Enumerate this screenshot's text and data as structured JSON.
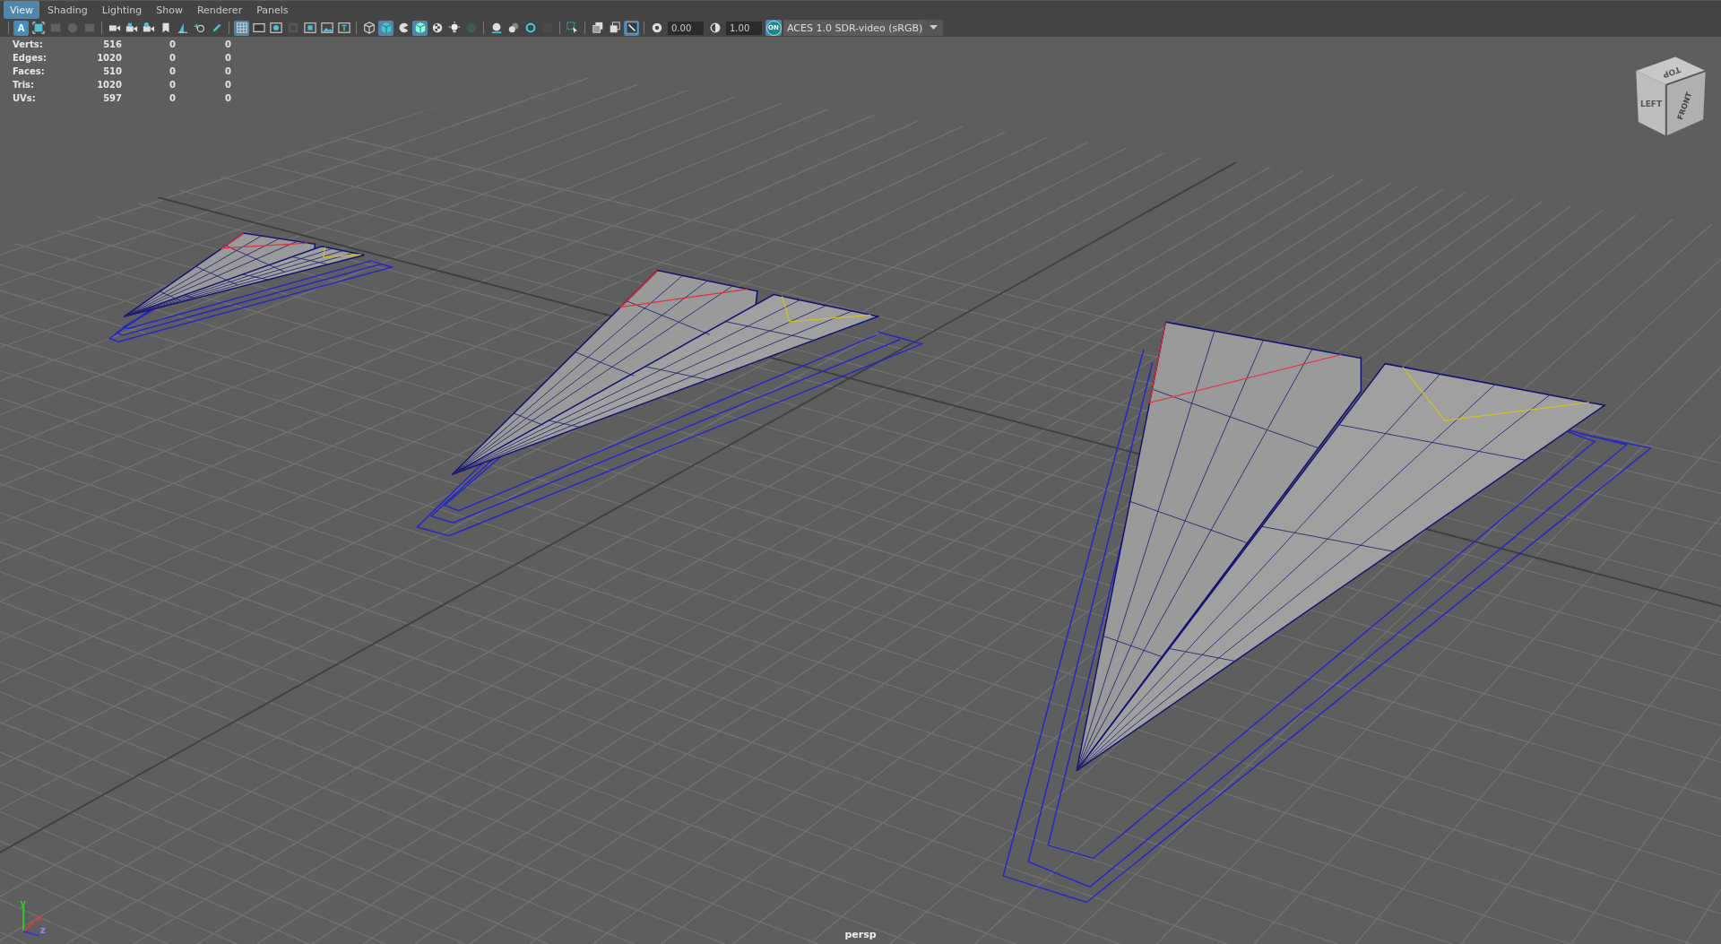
{
  "menu": [
    {
      "label": "View",
      "selected": true
    },
    {
      "label": "Shading",
      "selected": false
    },
    {
      "label": "Lighting",
      "selected": false
    },
    {
      "label": "Show",
      "selected": false
    },
    {
      "label": "Renderer",
      "selected": false
    },
    {
      "label": "Panels",
      "selected": false
    }
  ],
  "toolbar": {
    "groups": [
      [
        {
          "label": "A",
          "on": true,
          "disabled": false
        },
        {
          "on": false,
          "disabled": false
        },
        {
          "on": false,
          "disabled": true
        },
        {
          "on": false,
          "disabled": true
        },
        {
          "on": false,
          "disabled": true
        }
      ],
      [
        {
          "on": false,
          "disabled": false
        },
        {
          "on": false,
          "disabled": false
        },
        {
          "on": false,
          "disabled": false
        },
        {
          "on": false,
          "disabled": false
        },
        {
          "on": false,
          "disabled": false
        },
        {
          "on": false,
          "disabled": false
        },
        {
          "on": false,
          "disabled": false
        }
      ],
      [
        {
          "on": true,
          "disabled": false
        },
        {
          "on": false,
          "disabled": false
        },
        {
          "on": false,
          "disabled": false
        },
        {
          "on": false,
          "disabled": true
        },
        {
          "on": false,
          "disabled": false
        },
        {
          "on": false,
          "disabled": false
        },
        {
          "on": false,
          "disabled": false
        }
      ],
      [
        {
          "on": false,
          "disabled": false
        },
        {
          "on": true,
          "disabled": false
        },
        {
          "on": false,
          "disabled": false
        },
        {
          "on": true,
          "disabled": false
        },
        {
          "on": false,
          "disabled": false
        },
        {
          "on": false,
          "disabled": false
        },
        {
          "on": false,
          "disabled": true
        }
      ],
      [
        {
          "on": false,
          "disabled": false
        },
        {
          "on": false,
          "disabled": false
        },
        {
          "on": false,
          "disabled": false
        },
        {
          "on": false,
          "disabled": true
        }
      ],
      [
        {
          "on": false,
          "disabled": false
        }
      ],
      [
        {
          "on": false,
          "disabled": false
        },
        {
          "on": false,
          "disabled": false
        },
        {
          "on": true,
          "disabled": false
        }
      ]
    ],
    "exposure": "0.00",
    "gamma": "1.00",
    "color_management": {
      "label": "ON",
      "on": true
    },
    "color_space": "ACES 1.0 SDR-video (sRGB)"
  },
  "stats": [
    {
      "label": "Verts:",
      "values": [
        "516",
        "0",
        "0"
      ]
    },
    {
      "label": "Edges:",
      "values": [
        "1020",
        "0",
        "0"
      ]
    },
    {
      "label": "Faces:",
      "values": [
        "510",
        "0",
        "0"
      ]
    },
    {
      "label": "Tris:",
      "values": [
        "1020",
        "0",
        "0"
      ]
    },
    {
      "label": "UVs:",
      "values": [
        "597",
        "0",
        "0"
      ]
    }
  ],
  "view_cube": {
    "faces": [
      "LEFT",
      "TOP",
      "FRONT"
    ]
  },
  "axis": {
    "labels": [
      "x",
      "y",
      "z"
    ]
  },
  "camera_label": "persp"
}
